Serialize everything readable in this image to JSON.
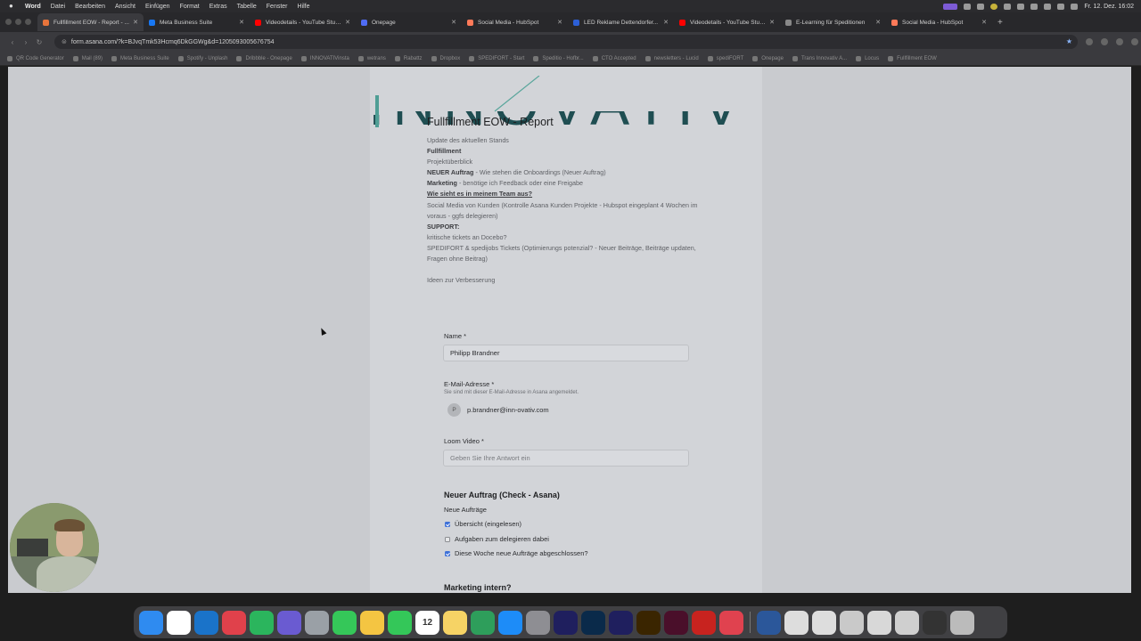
{
  "menubar": {
    "app": "Word",
    "items": [
      "Datei",
      "Bearbeiten",
      "Ansicht",
      "Einfügen",
      "Format",
      "Extras",
      "Tabelle",
      "Fenster",
      "Hilfe"
    ],
    "clock": "Fr. 12. Dez. 16:02"
  },
  "tabs": [
    {
      "title": "Fullfillment EOW - Report - ...",
      "color": "#e8743b",
      "active": true
    },
    {
      "title": "Meta Business Suite",
      "color": "#1877f2"
    },
    {
      "title": "Videodetails - YouTube Studio",
      "color": "#ff0000"
    },
    {
      "title": "Onepage",
      "color": "#4f6cf5"
    },
    {
      "title": "Social Media - HubSpot",
      "color": "#ff7a59"
    },
    {
      "title": "LED Reklame Dettendorfer...",
      "color": "#2c5fd6"
    },
    {
      "title": "Videodetails - YouTube Studio",
      "color": "#ff0000"
    },
    {
      "title": "E-Learning für Speditionen",
      "color": "#888888"
    },
    {
      "title": "Social Media - HubSpot",
      "color": "#ff7a59"
    }
  ],
  "url": "form.asana.com/?k=BJvqTmk53Hcmq6DkGGWg&d=1205093005676754",
  "bookmarks": [
    "QR Code Generator",
    "Mail (89)",
    "Meta Business Suite",
    "Spotify - Unplash",
    "Dribbble - Onepage",
    "INNOVATIVinsta",
    "wetrans",
    "Rabattz",
    "Dropbox",
    "SPEDIFORT - Start",
    "Speditio - Hofbr...",
    "CTO Accepted",
    "newsletters - Lucid",
    "spediFORT",
    "Onepage",
    "Trans Innovativ A...",
    "Locus",
    "Fullfillment EOW"
  ],
  "logo_text": "INNOVATIV",
  "form": {
    "title": "Fullfillment EOW - Report",
    "desc": {
      "l1": "Update des aktuellen Stands",
      "l2": "Fullfillment",
      "l3": "Projektüberblick",
      "l4a": "NEUER Auftrag",
      "l4b": " - Wie stehen die Onboardings (Neuer Auftrag)",
      "l5a": "Marketing",
      "l5b": " - benötige ich Feedback oder eine Freigabe",
      "l6": "Wie sieht es in meinem Team aus?",
      "l7": "Social Media von Kunden (Kontrolle Asana Kunden Projekte - Hubspot eingeplant 4 Wochen im voraus - ggfs delegieren)",
      "l8": "SUPPORT:",
      "l9": "kritische tickets an Docebo?",
      "l10": "SPEDIFORT & spedijobs Tickets (Optimierungs potenzial? - Neuer Beiträge, Beiträge updaten, Fragen ohne Beitrag)",
      "l11": "Ideen zur Verbesserung"
    },
    "name_label": "Name",
    "name_value": "Philipp Brandner",
    "email_label": "E-Mail-Adresse",
    "email_sub": "Sie sind mit dieser E-Mail-Adresse in Asana angemeldet.",
    "email_avatar": "P",
    "email_value": "p.brandner@inn-ovativ.com",
    "loom_label": "Loom Video",
    "loom_placeholder": "Geben Sie Ihre Antwort ein",
    "required_mark": "*",
    "section1_title": "Neuer Auftrag (Check - Asana)",
    "section1_sub": "Neue Aufträge",
    "checkboxes": [
      {
        "label": "Übersicht (eingelesen)",
        "checked": true
      },
      {
        "label": "Aufgaben zum delegieren dabei",
        "checked": false
      },
      {
        "label": "Diese Woche neue Aufträge abgeschlossen?",
        "checked": true
      }
    ],
    "section2_title": "Marketing intern?"
  },
  "dock": {
    "calendar_day": "12",
    "apps": [
      "finder-icon",
      "chrome-icon",
      "outlook-icon",
      "app-icon",
      "app-icon",
      "teams-icon",
      "app-icon",
      "messages-icon",
      "photos-icon",
      "facetime-icon",
      "calendar-icon",
      "notes-icon",
      "app-icon",
      "appstore-icon",
      "settings-icon",
      "premiere-icon",
      "photoshop-icon",
      "aftereffects-icon",
      "illustrator-icon",
      "indesign-icon",
      "acrobat-icon",
      "creativecloud-icon",
      "word-icon",
      "app-icon",
      "app-icon",
      "folder-icon",
      "folder-icon",
      "folder-icon",
      "folder-icon",
      "trash-icon"
    ]
  }
}
